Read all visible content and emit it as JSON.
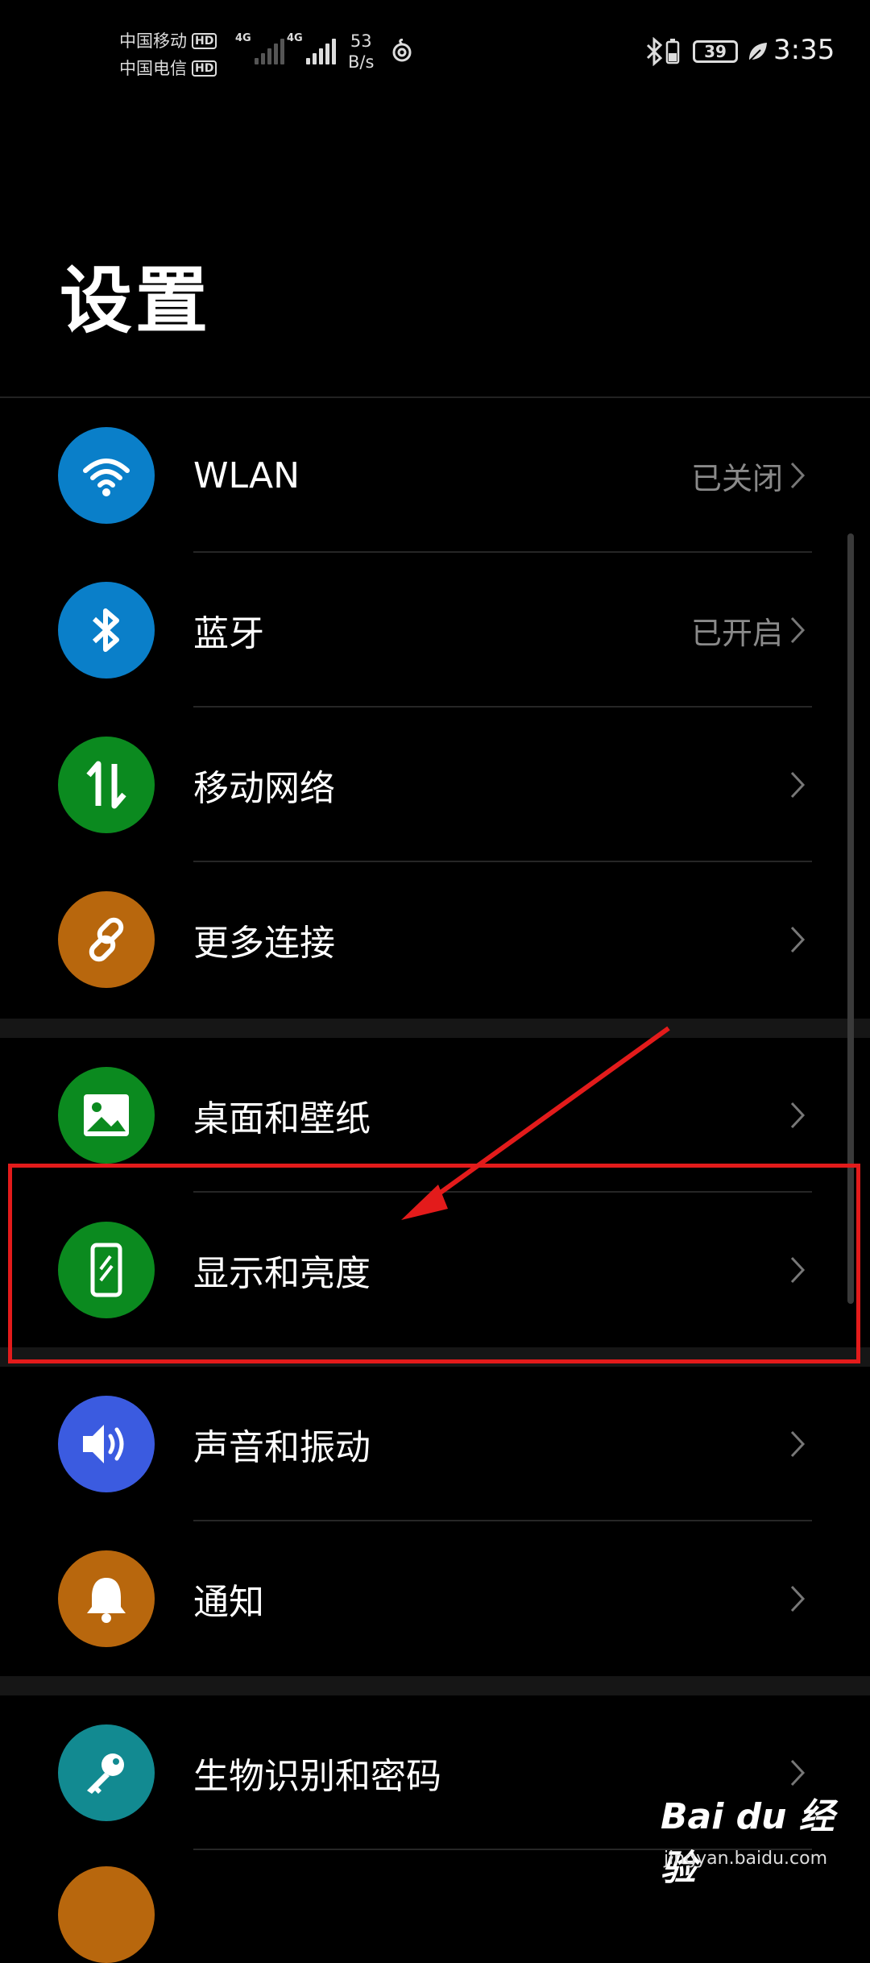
{
  "status_bar": {
    "carrier1": "中国移动",
    "carrier2": "中国电信",
    "hd_label": "HD",
    "network1": "4G",
    "network2": "4G",
    "speed_value": "53",
    "speed_unit": "B/s",
    "battery_level": "39",
    "time": "3:35"
  },
  "page_title": "设置",
  "groups": [
    {
      "items": [
        {
          "label": "WLAN",
          "value": "已关闭",
          "icon": "wifi-icon",
          "color": "#0a7fc9"
        },
        {
          "label": "蓝牙",
          "value": "已开启",
          "icon": "bluetooth-icon",
          "color": "#0a7fc9"
        },
        {
          "label": "移动网络",
          "value": "",
          "icon": "mobile-data-icon",
          "color": "#0b8a1f"
        },
        {
          "label": "更多连接",
          "value": "",
          "icon": "link-icon",
          "color": "#b8670d"
        }
      ]
    },
    {
      "items": [
        {
          "label": "桌面和壁纸",
          "value": "",
          "icon": "wallpaper-icon",
          "color": "#0b8a1f"
        },
        {
          "label": "显示和亮度",
          "value": "",
          "icon": "display-icon",
          "color": "#0b8a1f"
        }
      ]
    },
    {
      "items": [
        {
          "label": "声音和振动",
          "value": "",
          "icon": "sound-icon",
          "color": "#3b5be0"
        },
        {
          "label": "通知",
          "value": "",
          "icon": "bell-icon",
          "color": "#b8670d"
        }
      ]
    },
    {
      "items": [
        {
          "label": "生物识别和密码",
          "value": "",
          "icon": "key-icon",
          "color": "#128a91"
        }
      ]
    }
  ],
  "watermark": {
    "main": "Bai du 经验",
    "sub": "jingyan.baidu.com"
  },
  "colors": {
    "highlight": "#e31b1b",
    "background": "#000000"
  }
}
